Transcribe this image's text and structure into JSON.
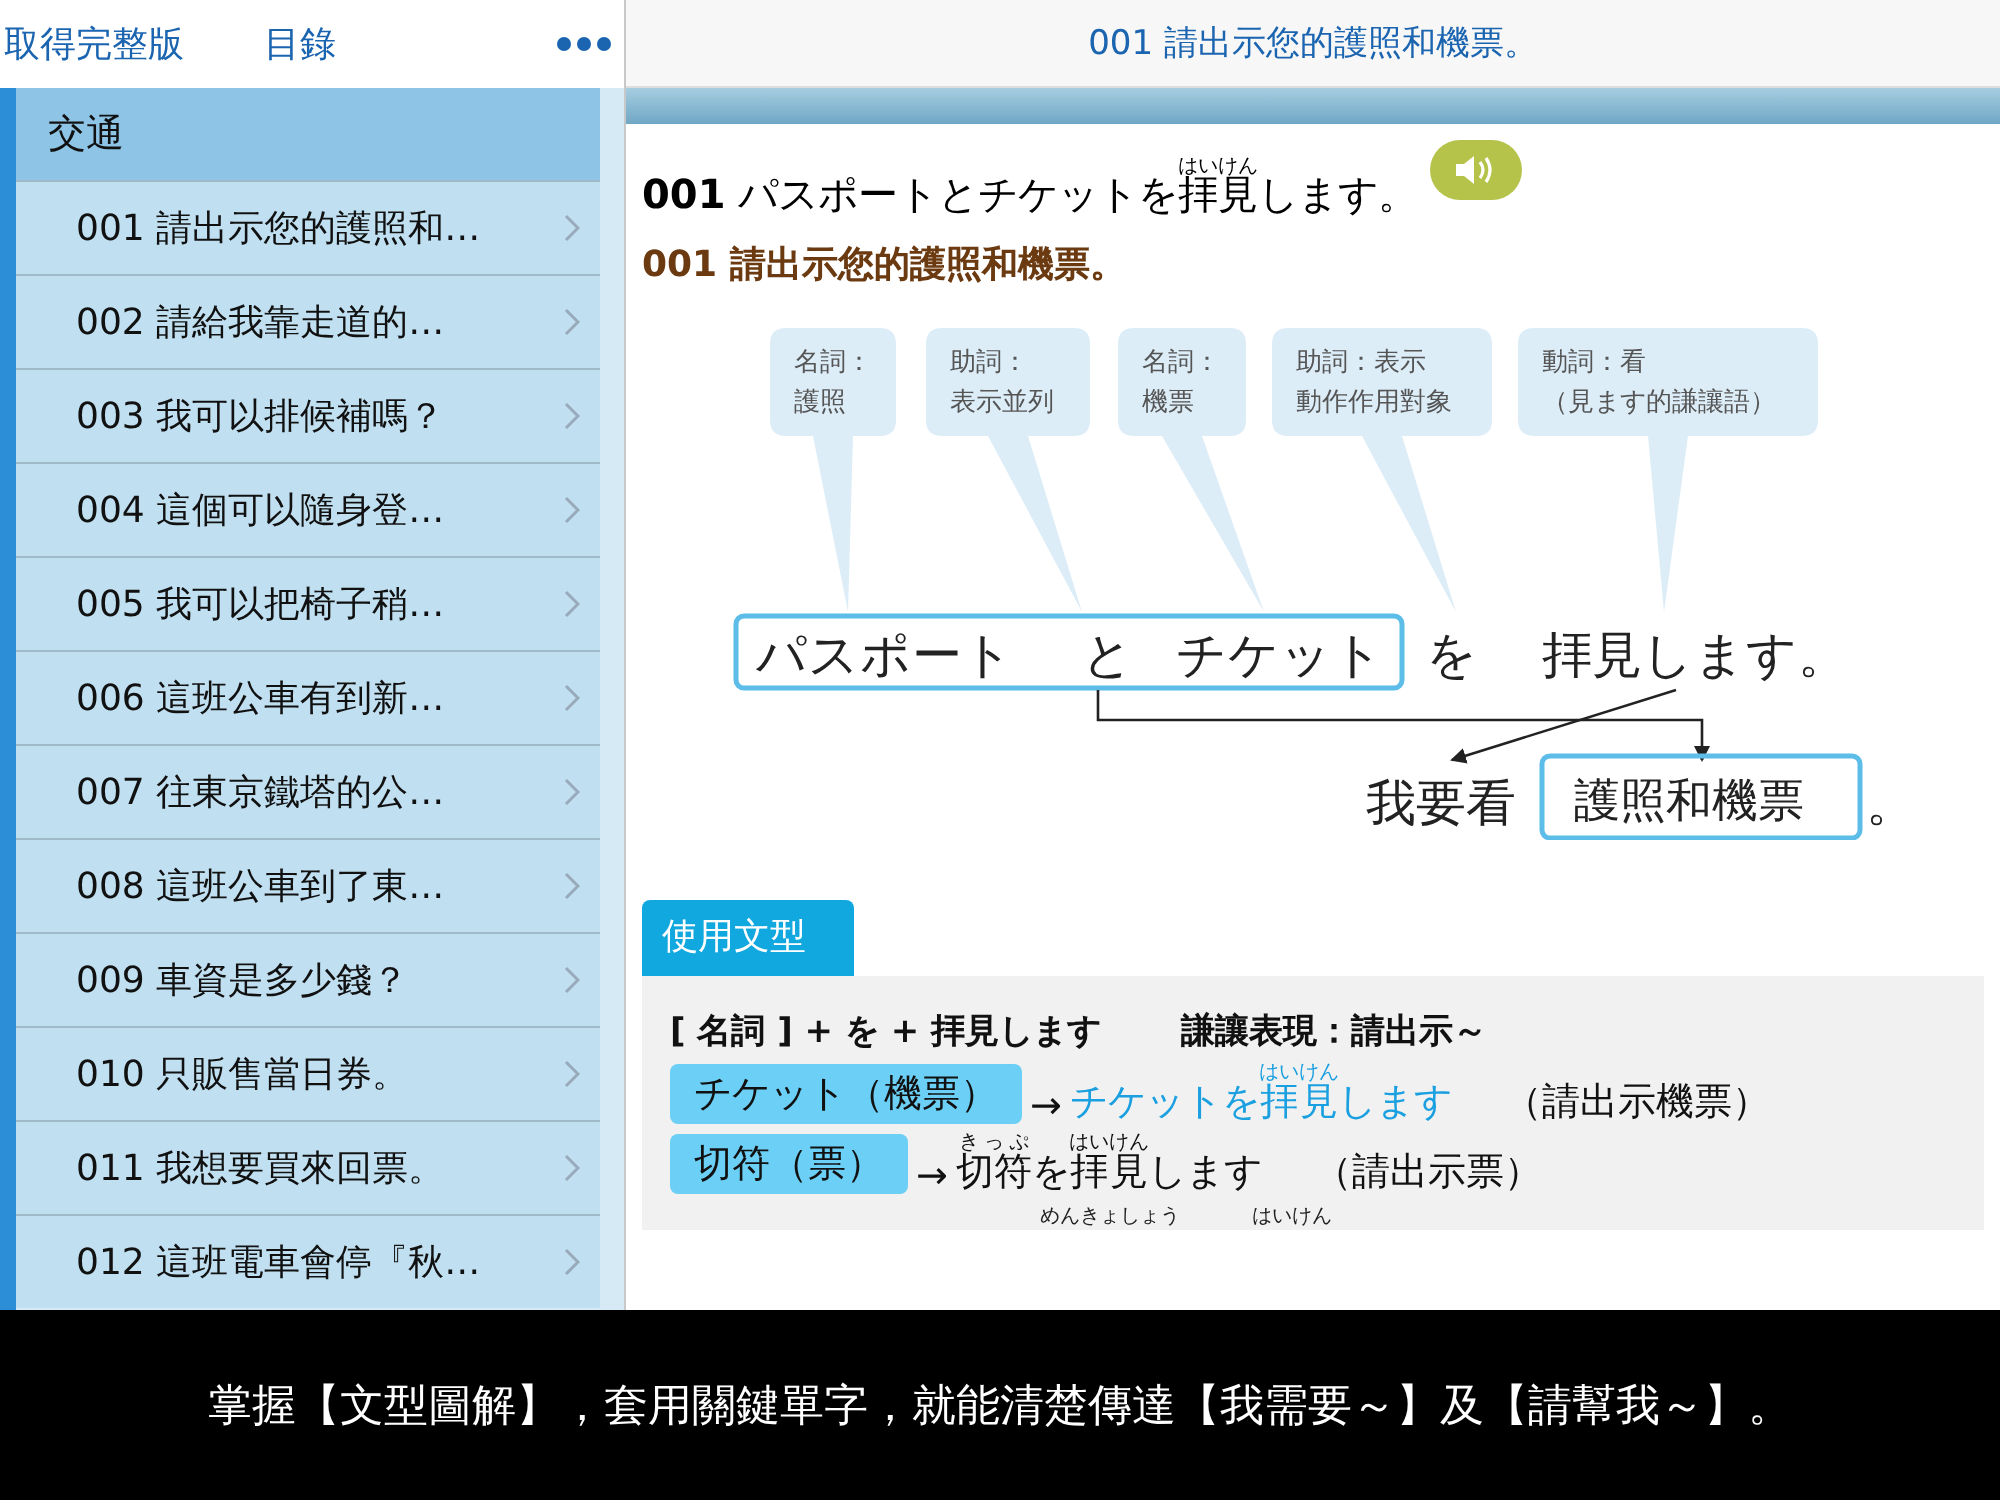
{
  "toolbar": {
    "buttons": [
      "取得完整版",
      "目錄"
    ]
  },
  "header": {
    "title": "001 請出示您的護照和機票。"
  },
  "sidebar": {
    "section": "交通",
    "items": [
      {
        "label": "001 請出示您的護照和…"
      },
      {
        "label": "002 請給我靠走道的…"
      },
      {
        "label": "003 我可以排候補嗎？"
      },
      {
        "label": "004 這個可以隨身登…"
      },
      {
        "label": "005 我可以把椅子稍…"
      },
      {
        "label": "006 這班公車有到新…"
      },
      {
        "label": "007 往東京鐵塔的公…"
      },
      {
        "label": "008 這班公車到了東…"
      },
      {
        "label": "009 車資是多少錢？"
      },
      {
        "label": "010 只販售當日券。"
      },
      {
        "label": "011 我想要買來回票。"
      },
      {
        "label": "012 這班電車會停『秋…"
      }
    ]
  },
  "lesson": {
    "number": "001",
    "sentence": [
      {
        "t": "パスポートとチケットを"
      },
      {
        "t": "拝見",
        "r": "はいけん"
      },
      {
        "t": "します。"
      }
    ],
    "translation": "001 請出示您的護照和機票。"
  },
  "diagram": {
    "bubbles": [
      {
        "lines": [
          "名詞：",
          "護照"
        ]
      },
      {
        "lines": [
          "助詞：",
          "表示並列"
        ]
      },
      {
        "lines": [
          "名詞：",
          "機票"
        ]
      },
      {
        "lines": [
          "助詞：表示",
          "動作作用對象"
        ]
      },
      {
        "lines": [
          "動詞：看",
          "（見ます的謙讓語）"
        ]
      }
    ],
    "boxed_words": [
      "パスポート",
      "と",
      "チケット"
    ],
    "words": [
      "を",
      "拝見します。"
    ],
    "meaning_lead": "我要看",
    "meaning_boxed": "護照和機票",
    "meaning_end": "。"
  },
  "pattern": {
    "tab": "使用文型",
    "formula": "[ 名詞 ] + を + 拝見します",
    "meaning": "謙讓表現：請出示～",
    "examples": [
      {
        "chip": "チケット（機票）",
        "arrow": "→",
        "highlight": true,
        "result": [
          {
            "t": "チケットを"
          },
          {
            "t": "拝見",
            "r": "はいけん"
          },
          {
            "t": "します"
          }
        ],
        "translation": "（請出示機票）"
      },
      {
        "chip": "切符（票）",
        "arrow": "→",
        "highlight": false,
        "result": [
          {
            "t": "切符",
            "r": "きっぷ"
          },
          {
            "t": "を"
          },
          {
            "t": "拝見",
            "r": "はいけん"
          },
          {
            "t": "します"
          }
        ],
        "translation": "（請出示票）"
      }
    ],
    "cut_ruby": [
      "めんきょしょう",
      "はいけん"
    ]
  },
  "caption": "掌握【文型圖解】，套用關鍵單字，就能清楚傳達【我需要～】及【請幫我～】。"
}
